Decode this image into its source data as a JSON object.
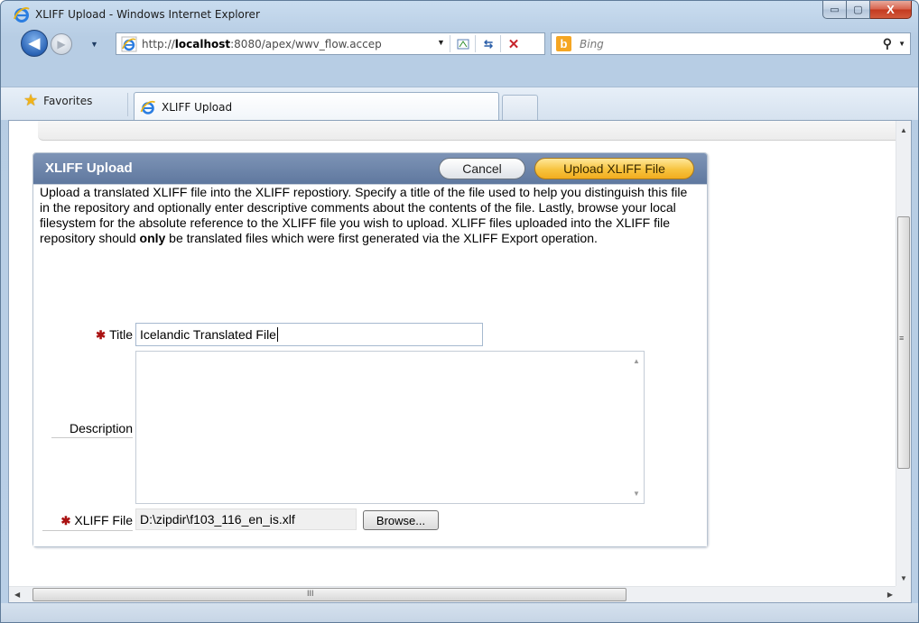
{
  "window": {
    "title": "XLIFF Upload - Windows Internet Explorer",
    "caption_min": "▭",
    "caption_max": "▢",
    "caption_close": "X"
  },
  "nav": {
    "back_icon": "◀",
    "forward_icon": "▶",
    "dropdown": "▼"
  },
  "address": {
    "url_prefix": "http://",
    "url_host": "localhost",
    "url_rest": ":8080/apex/wwv_flow.accep",
    "dropdown": "▼"
  },
  "search": {
    "provider": "Bing",
    "logo_letter": "b",
    "go_icon": "⚲",
    "dropdown": "▼"
  },
  "favorites": {
    "label": "Favorites"
  },
  "tabs": [
    {
      "label": "XLIFF Upload"
    }
  ],
  "region": {
    "title": "XLIFF Upload",
    "cancel_label": "Cancel",
    "upload_label": "Upload XLIFF File",
    "intro_part1": "Upload a translated XLIFF file into the XLIFF repostiory. Specify a title of the file used to help you distinguish this file in the repository and optionally enter descriptive comments about the contents of the file. Lastly, browse your local filesystem for the absolute reference to the XLIFF file you wish to upload. XLIFF files uploaded into the XLIFF file repository should ",
    "intro_bold": "only",
    "intro_part2": " be translated files which were first generated via the XLIFF Export operation."
  },
  "form": {
    "required_marker": "✱",
    "title_label": "Title",
    "title_value": "Icelandic Translated File",
    "description_label": "Description",
    "description_value": "",
    "file_label": "XLIFF File",
    "file_value": "D:\\zipdir\\f103_116_en_is.xlf",
    "browse_label": "Browse..."
  },
  "scrollbars": {
    "up": "▲",
    "down": "▼",
    "left": "◀",
    "right": "▶",
    "grip_v": "≡",
    "grip_h": "III"
  },
  "colors": {
    "region_header": "#6a82a8",
    "upload_button": "#f7c33e",
    "required": "#aa1111"
  }
}
